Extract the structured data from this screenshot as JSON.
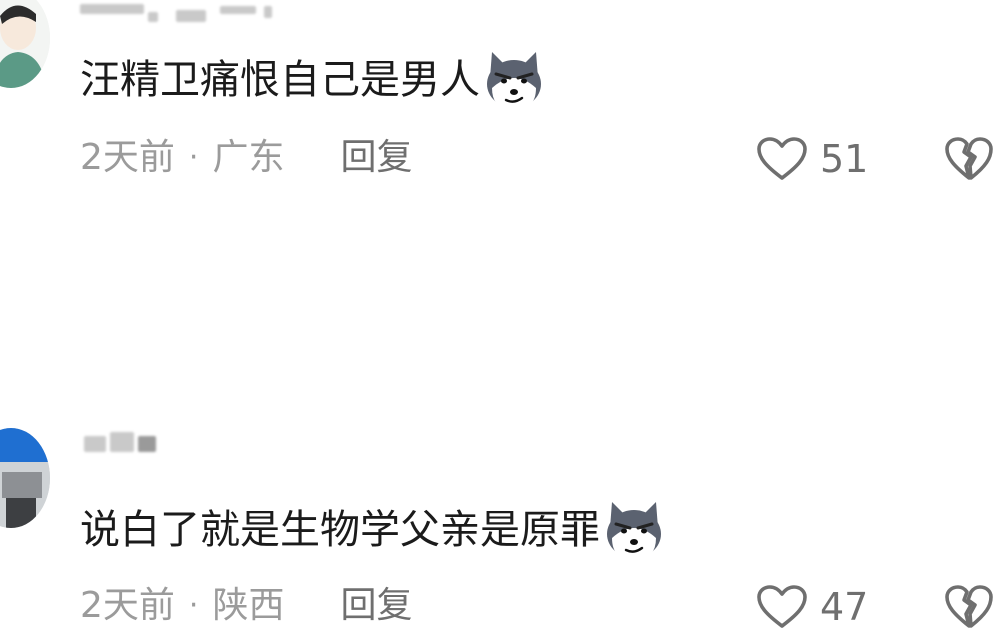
{
  "comments": [
    {
      "text": "汪精卫痛恨自己是男人",
      "emoji_icon": "dog-smirk-emoji-icon",
      "time": "2天前",
      "separator": "·",
      "location": "广东",
      "reply_label": "回复",
      "like_count": "51"
    },
    {
      "text": "说白了就是生物学父亲是原罪",
      "emoji_icon": "dog-smirk-emoji-icon",
      "time": "2天前",
      "separator": "·",
      "location": "陕西",
      "reply_label": "回复",
      "like_count": "47"
    }
  ],
  "colors": {
    "text": "#1b1b1b",
    "meta": "#9b9b9b",
    "icon": "#6f6f6f"
  }
}
